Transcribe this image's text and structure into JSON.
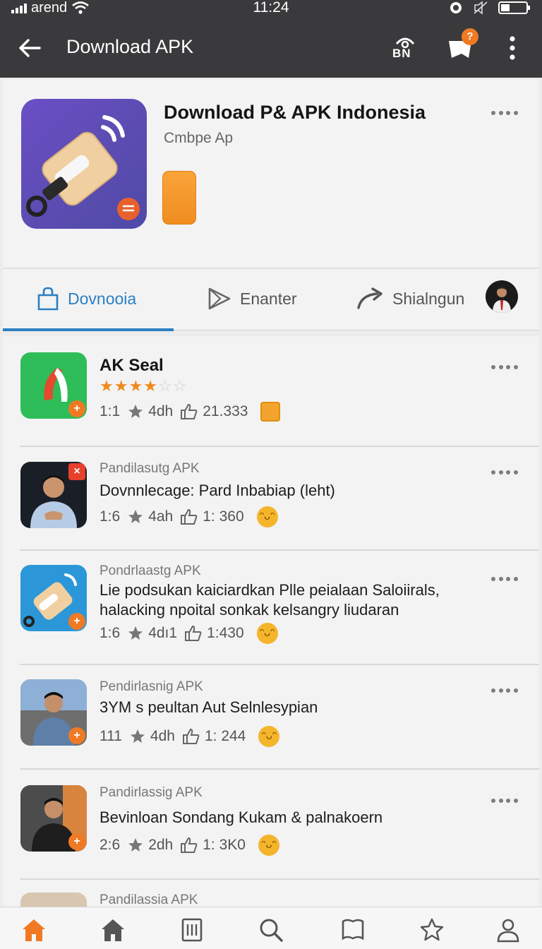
{
  "status_bar": {
    "carrier": "arend",
    "time": "11:24"
  },
  "app_bar": {
    "title": "Download APK",
    "cart_badge": "?",
    "account_icon": "BN"
  },
  "header": {
    "title": "Download P& APK Indonesia",
    "subtitle": "Cmbpe Ap"
  },
  "tabs": [
    {
      "label": "Dovnooia",
      "icon": "bag-icon",
      "active": true
    },
    {
      "label": "Enanter",
      "icon": "send-icon",
      "active": false
    },
    {
      "label": "Shialngun",
      "icon": "share-icon",
      "active": false
    }
  ],
  "items": [
    {
      "name": "AK Seal",
      "rating": 3,
      "rating_max": 5,
      "meta1": "1:1",
      "meta2": "4dh",
      "meta3": "21.333"
    },
    {
      "category": "Pandilasutg APK",
      "desc": "Dovnnlecage: Pard Inbabiap (leht)",
      "meta1": "1:6",
      "meta2": "4ah",
      "meta3": "1: 360"
    },
    {
      "category": "Pondrlaastg APK",
      "desc": "Lie podsukan kaiciardkan Plle peialaan Saloiirals, halacking npoital sonkak kelsangry liudaran",
      "meta1": "1:6",
      "meta2": "4dı1",
      "meta3": "1:430"
    },
    {
      "category": "Pendirlasnig APK",
      "desc": "3YM s peultan Aut Selnlesypian",
      "meta1": "111",
      "meta2": "4dh",
      "meta3": "1: 244"
    },
    {
      "category": "Pandirlassig APK",
      "desc": "Bevinloan Sondang Kukam & palnakoern",
      "meta1": "2:6",
      "meta2": "2dh",
      "meta3": "1: 3K0"
    },
    {
      "category": "Pandilassia APK"
    }
  ],
  "bottom_nav": [
    "home-icon-active",
    "home-icon",
    "document-icon",
    "search-icon",
    "bookmark-icon",
    "star-icon",
    "profile-icon"
  ],
  "colors": {
    "bar": "#3a3a3c",
    "accent_blue": "#2b7fc1",
    "accent_orange": "#f07a24",
    "star": "#ef8a1c"
  }
}
